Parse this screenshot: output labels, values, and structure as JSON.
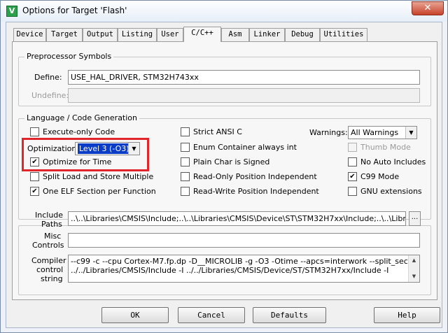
{
  "window": {
    "title": "Options for Target 'Flash'",
    "close_glyph": "✕",
    "app_icon_glyph": "V"
  },
  "tabs": [
    {
      "label": "Device"
    },
    {
      "label": "Target"
    },
    {
      "label": "Output"
    },
    {
      "label": "Listing"
    },
    {
      "label": "User"
    },
    {
      "label": "C/C++",
      "active": true
    },
    {
      "label": "Asm"
    },
    {
      "label": "Linker"
    },
    {
      "label": "Debug"
    },
    {
      "label": "Utilities"
    }
  ],
  "preprocessor": {
    "title": "Preprocessor Symbols",
    "define_label": "Define:",
    "define_value": "USE_HAL_DRIVER, STM32H743xx",
    "undefine_label": "Undefine:",
    "undefine_value": ""
  },
  "language": {
    "title": "Language / Code Generation",
    "execute_only": {
      "label": "Execute-only Code",
      "checked": false
    },
    "optimization_label": "Optimization:",
    "optimization_value": "Level 3 (-O3)",
    "optimize_time": {
      "label": "Optimize for Time",
      "checked": true
    },
    "split_load": {
      "label": "Split Load and Store Multiple",
      "checked": false
    },
    "one_elf": {
      "label": "One ELF Section per Function",
      "checked": true
    },
    "strict_ansi": {
      "label": "Strict ANSI C",
      "checked": false
    },
    "enum_container": {
      "label": "Enum Container always int",
      "checked": false
    },
    "plain_char": {
      "label": "Plain Char is Signed",
      "checked": false
    },
    "ro_pi": {
      "label": "Read-Only Position Independent",
      "checked": false
    },
    "rw_pi": {
      "label": "Read-Write Position Independent",
      "checked": false
    },
    "warnings_label": "Warnings:",
    "warnings_value": "All Warnings",
    "thumb_mode": {
      "label": "Thumb Mode",
      "checked": false,
      "disabled": true
    },
    "no_auto_includes": {
      "label": "No Auto Includes",
      "checked": false
    },
    "c99": {
      "label": "C99 Mode",
      "checked": true
    },
    "gnu_ext": {
      "label": "GNU extensions",
      "checked": false
    },
    "check_glyph": "✔"
  },
  "paths": {
    "include_label_1": "Include",
    "include_label_2": "Paths",
    "include_value": "..\\..\\Libraries\\CMSIS\\Include;..\\..\\Libraries\\CMSIS\\Device\\ST\\STM32H7xx\\Include;..\\..\\Libraries\\S",
    "browse_label": "...",
    "misc_label_1": "Misc",
    "misc_label_2": "Controls",
    "misc_value": "",
    "compiler_label_1": "Compiler",
    "compiler_label_2": "control",
    "compiler_label_3": "string",
    "compiler_line_1": "--c99 -c --cpu Cortex-M7.fp.dp -D__MICROLIB -g -O3 -Otime --apcs=interwork --split_sections -I",
    "compiler_line_2": "../../Libraries/CMSIS/Include -I ../../Libraries/CMSIS/Device/ST/STM32H7xx/Include -I"
  },
  "buttons": {
    "ok": "OK",
    "cancel": "Cancel",
    "defaults": "Defaults",
    "help": "Help"
  },
  "colors": {
    "highlight": "#e0262a",
    "selection": "#0a3cc8"
  }
}
